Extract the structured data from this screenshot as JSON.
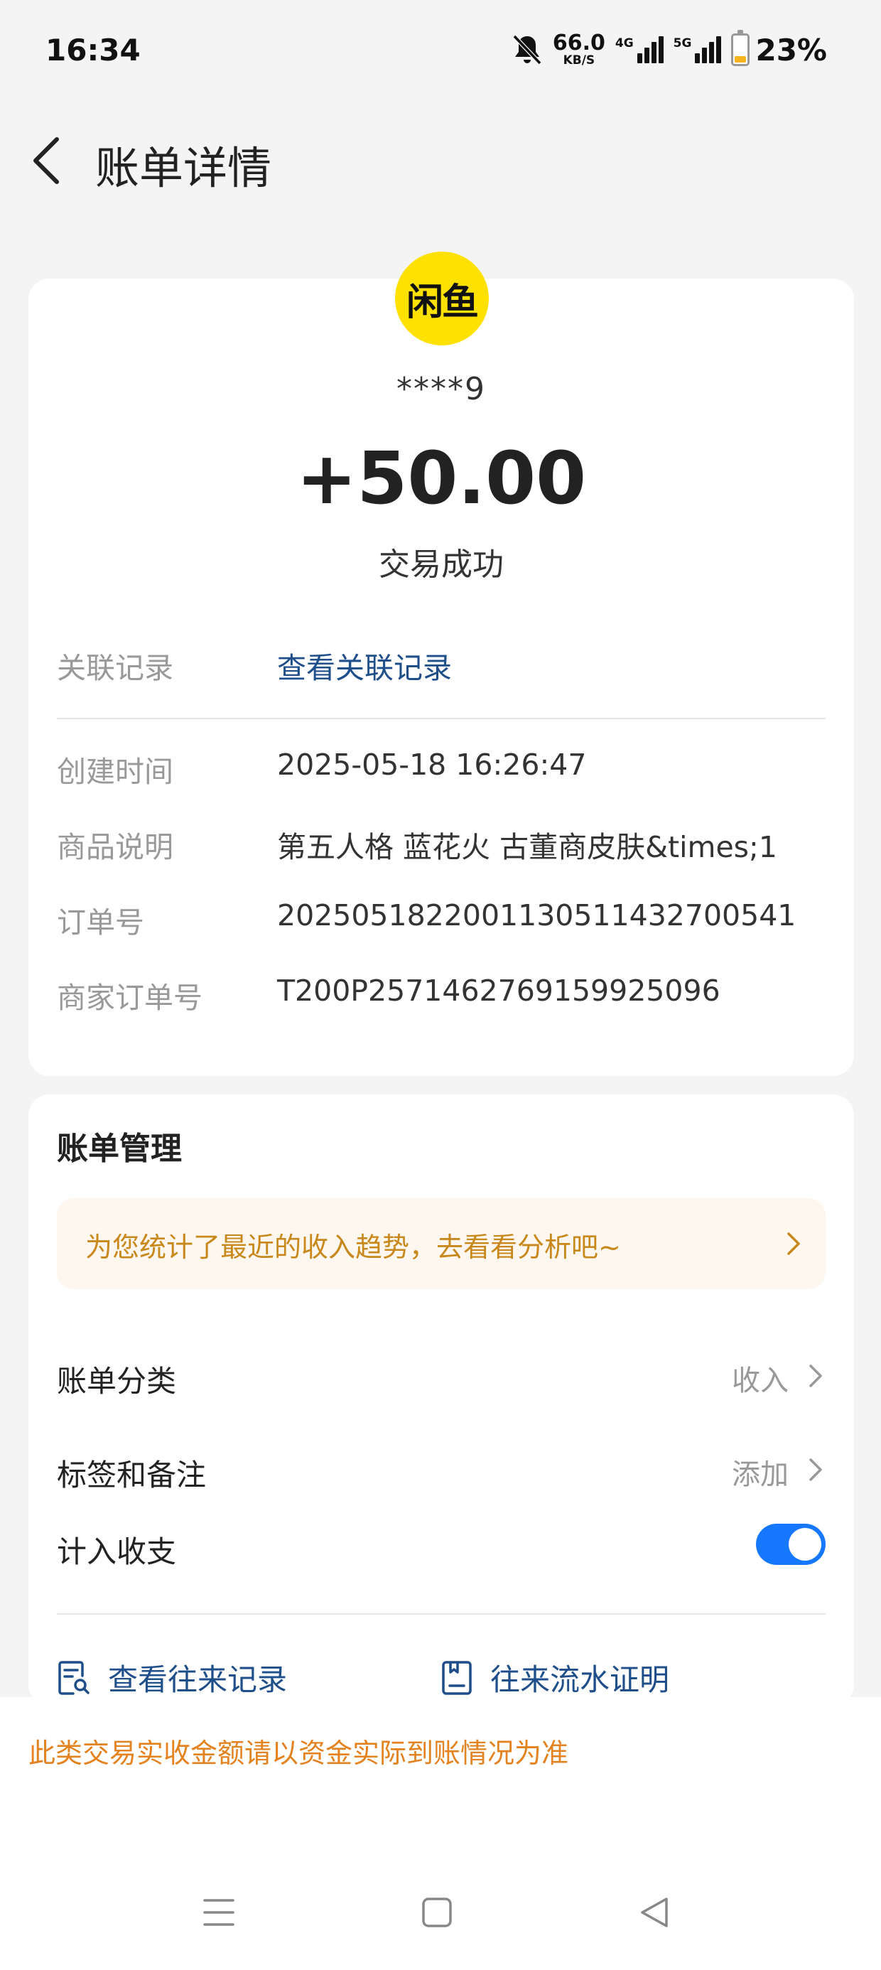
{
  "status_bar": {
    "time": "16:34",
    "net_speed": "66.0",
    "net_speed_unit": "KB/S",
    "net_type_1": "4G",
    "net_type_2": "5G",
    "battery": "23%",
    "battery_level": 0.23
  },
  "header": {
    "title": "账单详情"
  },
  "transaction": {
    "merchant_logo_text": "闲鱼",
    "merchant_logo_color": "#ffe100",
    "payer": "****9",
    "amount": "+50.00",
    "status": "交易成功"
  },
  "details": {
    "related": {
      "label": "关联记录",
      "value": "查看关联记录"
    },
    "rows": [
      {
        "label": "创建时间",
        "value": "2025-05-18 16:26:47"
      },
      {
        "label": "商品说明",
        "value": "第五人格 蓝花火 古董商皮肤&times;1"
      },
      {
        "label": "订单号",
        "value": "2025051822001130511432700541"
      },
      {
        "label": "商家订单号",
        "value": "T200P2571462769159925096"
      }
    ]
  },
  "bill_management": {
    "title": "账单管理",
    "promo": "为您统计了最近的收入趋势，去看看分析吧~",
    "category": {
      "label": "账单分类",
      "value": "收入"
    },
    "tags": {
      "label": "标签和备注",
      "value": "添加"
    },
    "include": {
      "label": "计入收支",
      "enabled": true
    },
    "actions": [
      {
        "label": "查看往来记录",
        "icon": "search-record-icon"
      },
      {
        "label": "往来流水证明",
        "icon": "statement-icon"
      }
    ]
  },
  "footer": {
    "note": "此类交易实收金额请以资金实际到账情况为准"
  },
  "colors": {
    "accent_blue": "#1677ff",
    "link_blue": "#1f4f8a",
    "promo_text": "#c9881b",
    "footer_note": "#e3821f"
  }
}
